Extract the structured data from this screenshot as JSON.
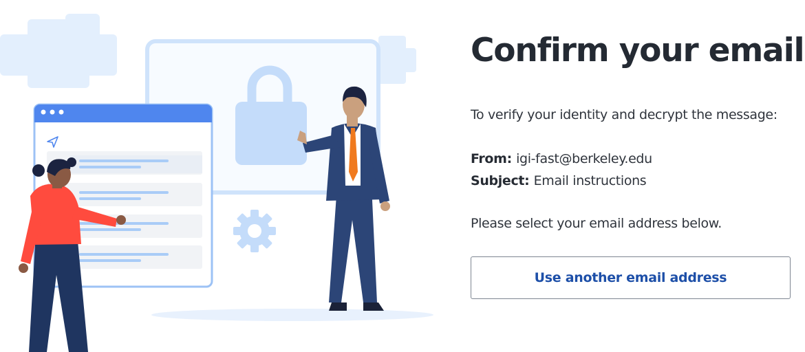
{
  "page": {
    "title": "Confirm your email",
    "intro": "To verify your identity and decrypt the message:",
    "from_label": "From:",
    "from_value": "igi-fast@berkeley.edu",
    "subject_label": "Subject:",
    "subject_value": "Email instructions",
    "instruction": "Please select your email address below.",
    "alt_button_label": "Use another email address"
  },
  "colors": {
    "accent": "#1d4fa8",
    "title_text": "#242a33",
    "button_border": "#7d8591",
    "illustration_light_blue": "#cfe3fb",
    "browser_bar_blue": "#4f86ee"
  },
  "illustration": {
    "icons": [
      "lock-icon",
      "gear-icon",
      "send-icon"
    ]
  }
}
